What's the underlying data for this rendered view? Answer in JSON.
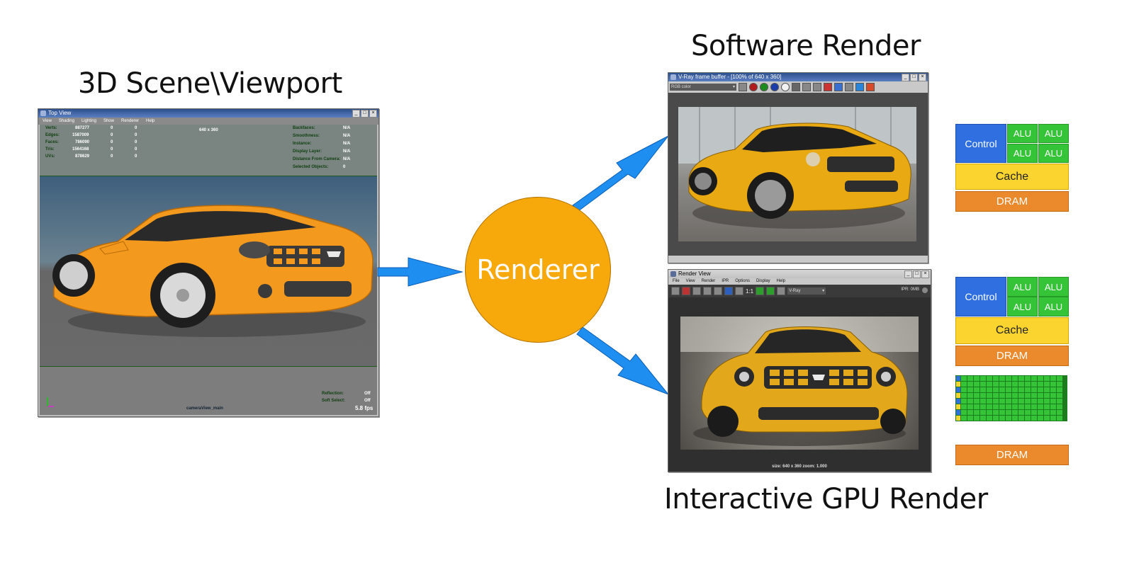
{
  "titles": {
    "scene": "3D Scene\\Viewport",
    "software": "Software Render",
    "gpu": "Interactive GPU Render"
  },
  "renderer_label": "Renderer",
  "viewport_window": {
    "title": "Top View",
    "menu": [
      "View",
      "Shading",
      "Lighting",
      "Show",
      "Renderer",
      "Help"
    ],
    "resolution": "640 x 360",
    "stats": [
      {
        "label": "Verts:",
        "v1": "887277",
        "v2": "0",
        "v3": "0"
      },
      {
        "label": "Edges:",
        "v1": "1587009",
        "v2": "0",
        "v3": "0"
      },
      {
        "label": "Faces:",
        "v1": "786090",
        "v2": "0",
        "v3": "0"
      },
      {
        "label": "Tris:",
        "v1": "1564168",
        "v2": "0",
        "v3": "0"
      },
      {
        "label": "UVs:",
        "v1": "878629",
        "v2": "0",
        "v3": "0"
      }
    ],
    "props": [
      {
        "label": "Backfaces:",
        "value": "N/A"
      },
      {
        "label": "Smoothness:",
        "value": "N/A"
      },
      {
        "label": "Instance:",
        "value": "N/A"
      },
      {
        "label": "Display Layer:",
        "value": "N/A"
      },
      {
        "label": "Distance From Camera:",
        "value": "N/A"
      },
      {
        "label": "Selected Objects:",
        "value": "0"
      }
    ],
    "reflection_label": "Reflection:",
    "reflection_value": "Off",
    "softselect_label": "Soft Select:",
    "softselect_value": "Off",
    "camera": "cameraView_main",
    "fps": "5.8 fps"
  },
  "vray_window": {
    "title": "V-Ray frame buffer - [100% of 640 x 360]",
    "channel": "RGB color"
  },
  "renderview_window": {
    "title": "Render View",
    "menu": [
      "File",
      "View",
      "Render",
      "IPR",
      "Options",
      "Display",
      "Help"
    ],
    "ratio": "1:1",
    "renderer": "V-Ray",
    "ipr": "IPR: 0MB",
    "status": "size: 640 x 360 zoom: 1.000"
  },
  "cpu_chip": {
    "control": "Control",
    "alu": "ALU",
    "cache": "Cache",
    "dram": "DRAM"
  },
  "gpu_chip": {
    "dram": "DRAM"
  },
  "colors": {
    "arrow": "#1e8ff0",
    "renderer": "#f7a80a",
    "car": "#f39a1e",
    "control": "#2f6fe0",
    "alu": "#35c437",
    "cache": "#fbd42f",
    "dram": "#eb8a2d"
  }
}
